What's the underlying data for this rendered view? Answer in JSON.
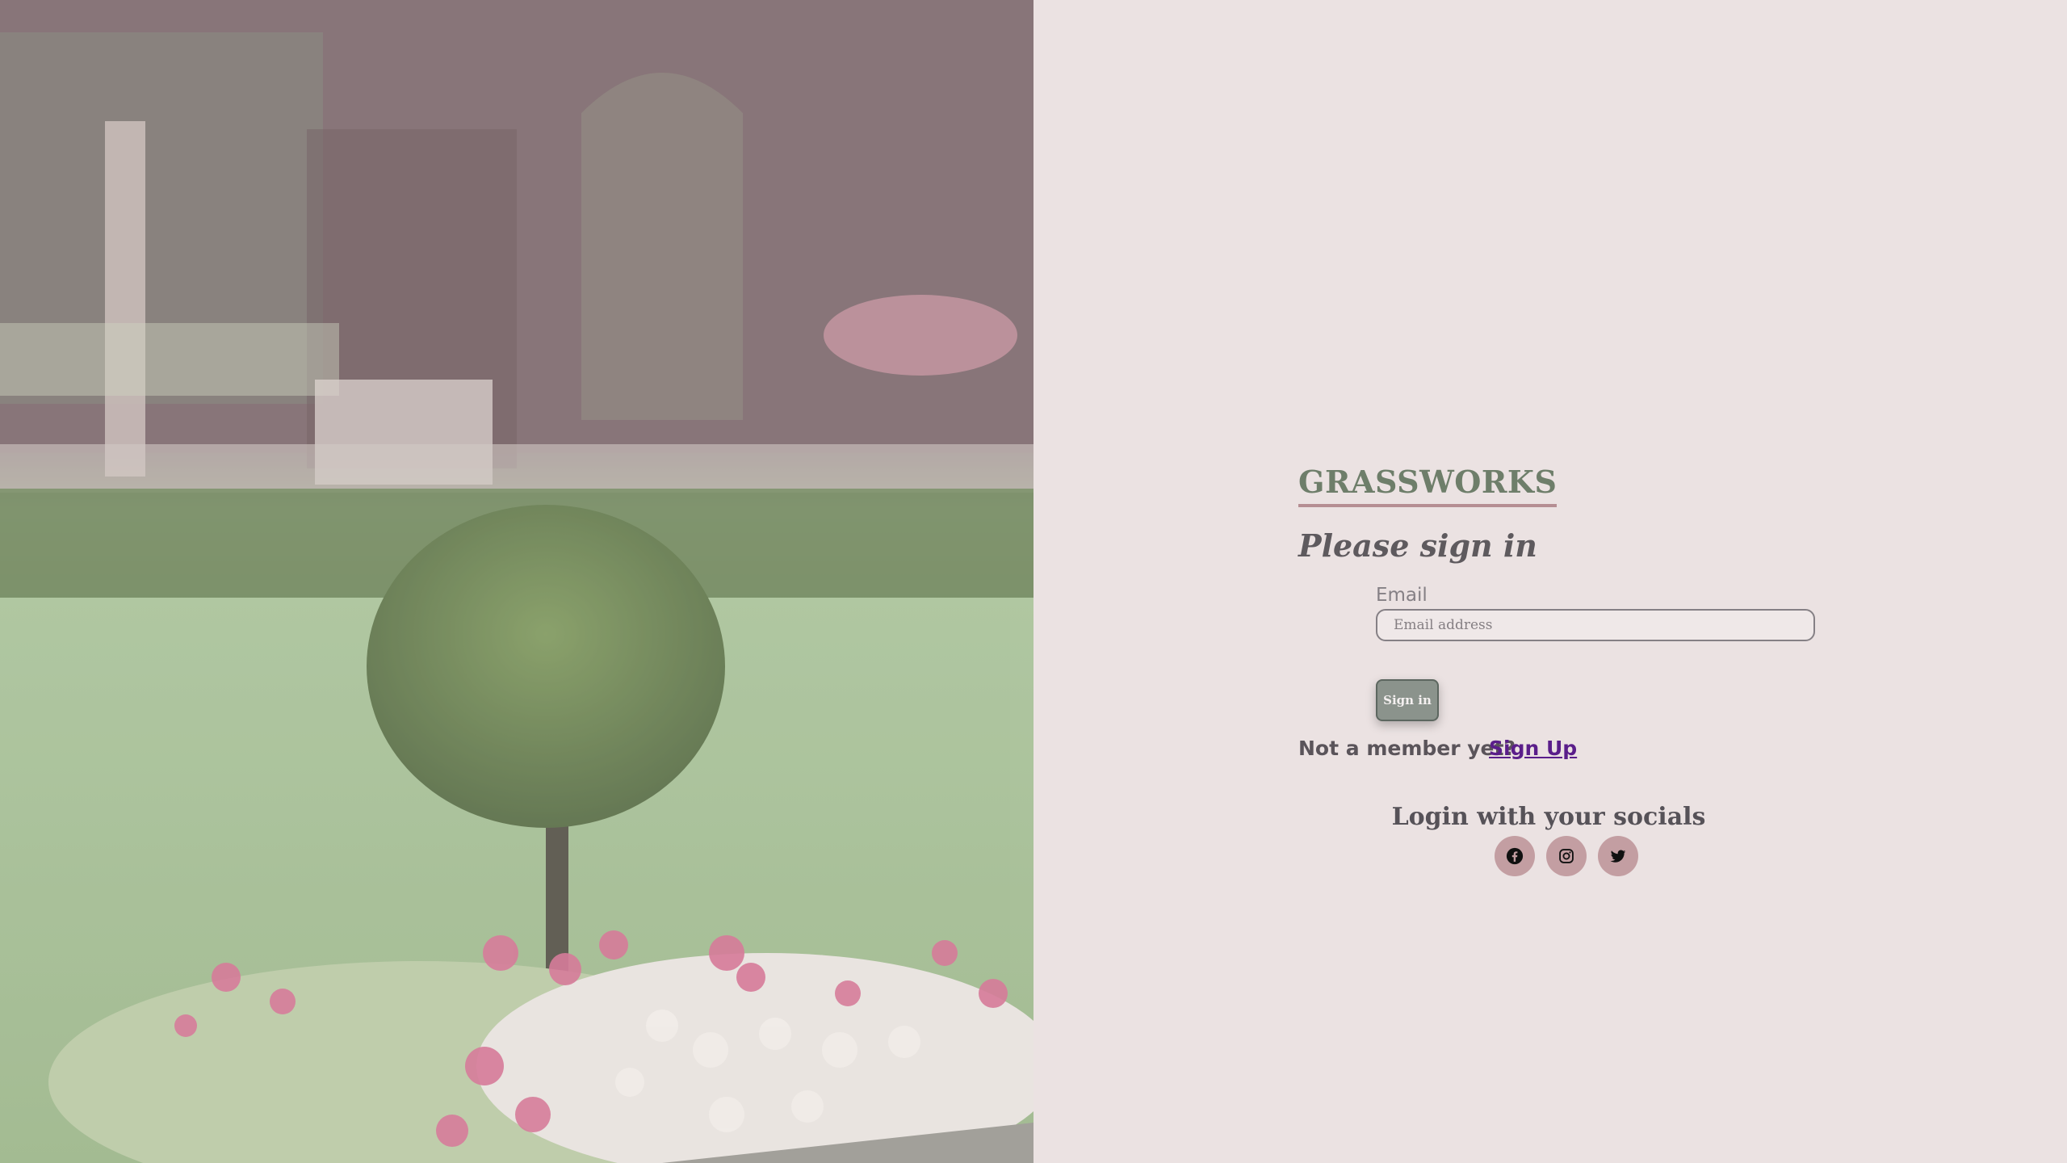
{
  "hero": {
    "image_description_icon": "garden-topiary-photo"
  },
  "brand": {
    "name": "GRASSWORKS",
    "color": "#6e7e6a",
    "underline_color": "#b58e93"
  },
  "form": {
    "title": "Please sign in",
    "email_label": "Email",
    "email_placeholder": "Email address",
    "email_value": "",
    "submit_label": "Sign in"
  },
  "signup": {
    "prompt": "Not a member yet?",
    "link_label": "Sign Up"
  },
  "socials": {
    "title": "Login with your socials",
    "buttons": [
      {
        "icon": "facebook-icon"
      },
      {
        "icon": "instagram-icon"
      },
      {
        "icon": "twitter-icon"
      }
    ],
    "button_color": "#c39ea2"
  },
  "colors": {
    "panel_background": "#ebe2e2",
    "link": "#5a1e8a",
    "button": "#8b938c"
  }
}
